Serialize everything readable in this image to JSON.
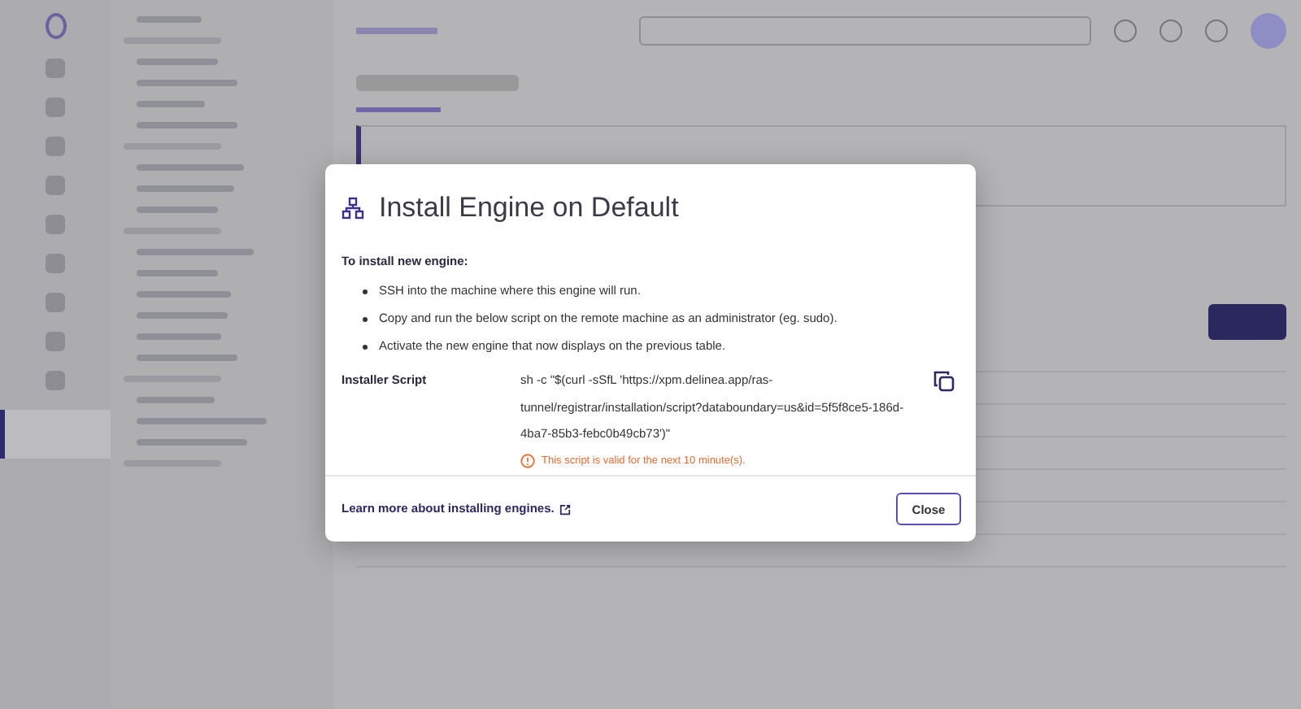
{
  "dialog": {
    "title": "Install Engine on Default",
    "intro": "To install new engine:",
    "steps": [
      "SSH into the machine where this engine will run.",
      "Copy and run the below script on the remote machine as an administrator (eg. sudo).",
      "Activate the new engine that now displays on the previous table."
    ],
    "script_label": "Installer Script",
    "script": "sh -c \"$(curl -sSfL 'https://xpm.delinea.app/ras-tunnel/registrar/installation/script?databoundary=us&id=5f5f8ce5-186d-4ba7-85b3-febc0b49cb73')\"",
    "warning": "This script is valid for the next 10 minute(s).",
    "link": "Learn more about installing engines.",
    "close": "Close"
  }
}
